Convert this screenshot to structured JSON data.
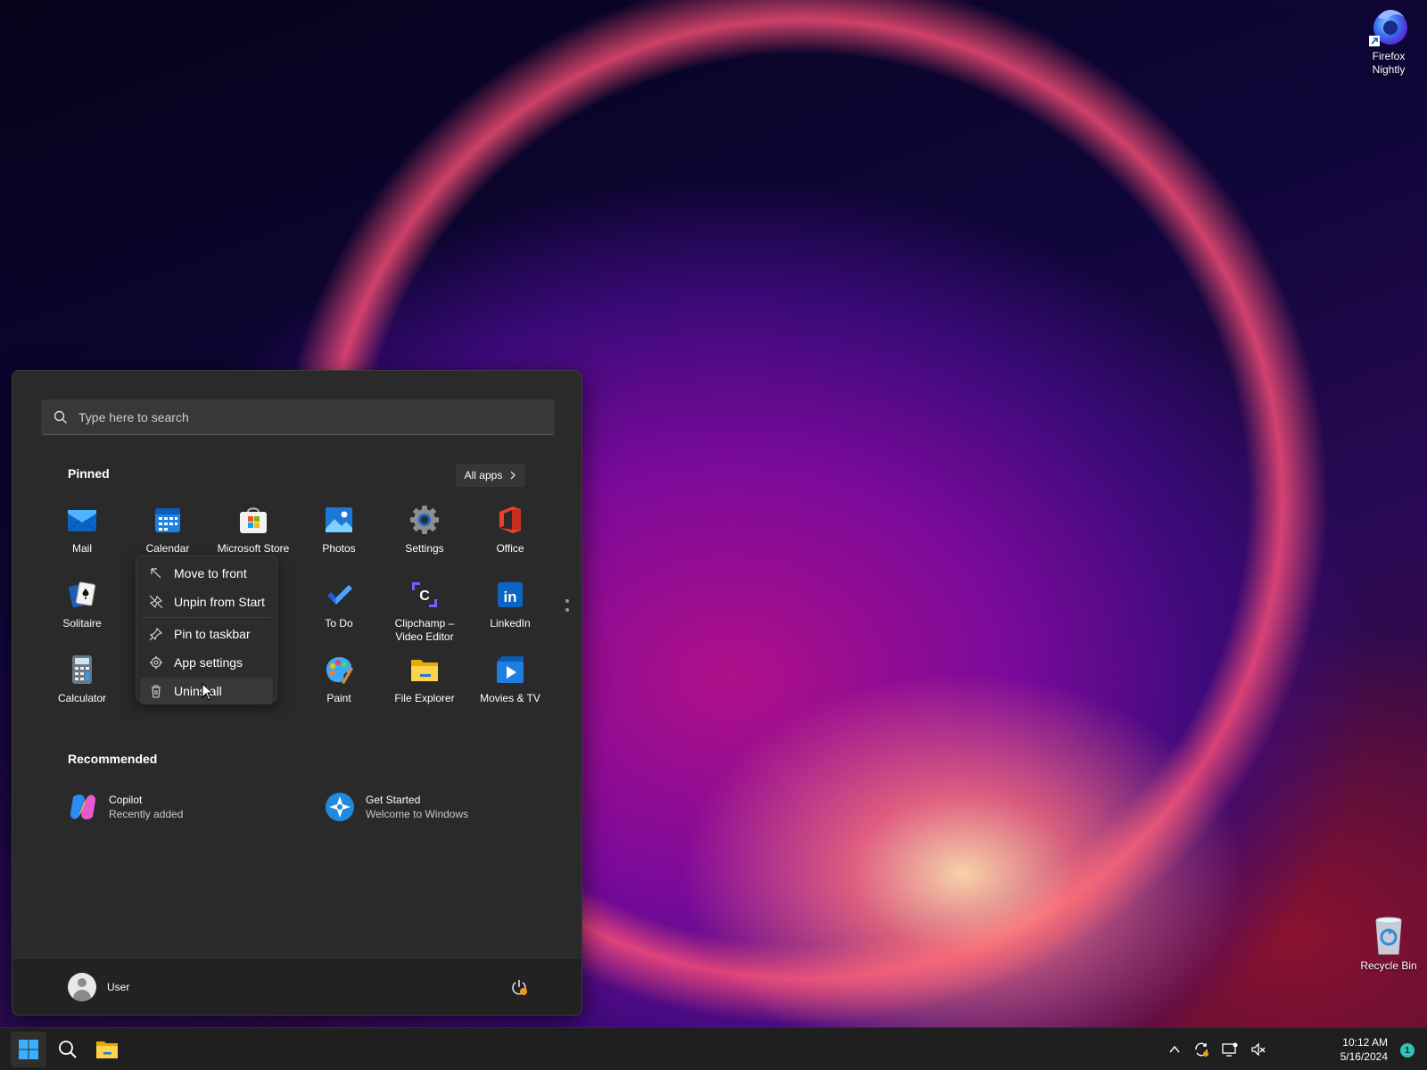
{
  "desktop": {
    "icons": [
      {
        "label_line1": "Firefox",
        "label_line2": "Nightly",
        "icon": "firefox-nightly-icon"
      },
      {
        "label": "Recycle Bin",
        "icon": "recycle-bin-icon"
      }
    ]
  },
  "start_menu": {
    "search": {
      "placeholder": "Type here to search",
      "icon": "search-icon"
    },
    "pinned_title": "Pinned",
    "all_apps_label": "All apps",
    "pinned_apps": [
      {
        "label": "Mail",
        "icon": "mail-icon"
      },
      {
        "label": "Calendar",
        "icon": "calendar-icon"
      },
      {
        "label": "Microsoft Store",
        "icon": "microsoft-store-icon"
      },
      {
        "label": "Photos",
        "icon": "photos-icon"
      },
      {
        "label": "Settings",
        "icon": "settings-icon"
      },
      {
        "label": "Office",
        "icon": "office-icon"
      },
      {
        "label": "Solitaire",
        "icon": "solitaire-icon"
      },
      {
        "label": "To Do",
        "icon": "todo-icon"
      },
      {
        "label_line1": "Clipchamp –",
        "label_line2": "Video Editor",
        "icon": "clipchamp-icon"
      },
      {
        "label": "LinkedIn",
        "icon": "linkedin-icon"
      },
      {
        "label": "Calculator",
        "icon": "calculator-icon"
      },
      {
        "label": "Paint",
        "icon": "paint-icon"
      },
      {
        "label": "File Explorer",
        "icon": "file-explorer-icon"
      },
      {
        "label": "Movies & TV",
        "icon": "movies-tv-icon"
      }
    ],
    "recommended_title": "Recommended",
    "recommended": [
      {
        "title": "Copilot",
        "subtitle": "Recently added",
        "icon": "copilot-icon"
      },
      {
        "title": "Get Started",
        "subtitle": "Welcome to Windows",
        "icon": "get-started-icon"
      }
    ],
    "user_name": "User"
  },
  "context_menu": {
    "items": [
      {
        "label": "Move to front",
        "icon": "move-to-front-icon"
      },
      {
        "label": "Unpin from Start",
        "icon": "unpin-icon"
      },
      {
        "label": "Pin to taskbar",
        "icon": "pin-icon"
      },
      {
        "label": "App settings",
        "icon": "gear-icon"
      },
      {
        "label": "Uninstall",
        "icon": "trash-icon",
        "hovered": true
      }
    ]
  },
  "taskbar": {
    "time": "10:12 AM",
    "date": "5/16/2024",
    "notification_count": "1"
  },
  "colors": {
    "accent": "#0078d4",
    "menu_bg": "#2a2a2a",
    "taskbar_bg": "#1f1f1f"
  }
}
